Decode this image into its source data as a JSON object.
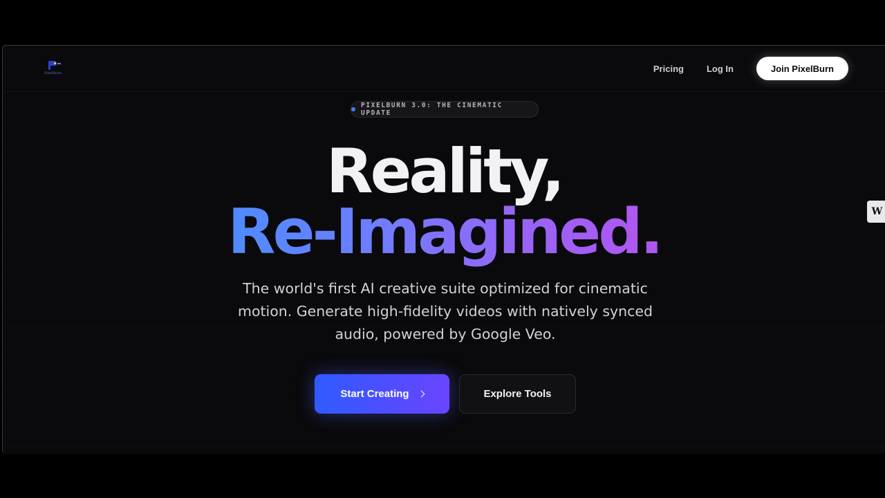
{
  "brand": {
    "name": "PixelBurn",
    "logo_text": "PixelBurn"
  },
  "nav": {
    "pricing_label": "Pricing",
    "login_label": "Log In",
    "join_label": "Join PixelBurn"
  },
  "badge": {
    "text": "PIXELBURN 3.0: THE CINEMATIC UPDATE"
  },
  "hero": {
    "headline_line1": "Reality,",
    "headline_line2": "Re-Imagined.",
    "subtext": "The world's first AI creative suite optimized for cinematic motion. Generate high-fidelity videos with natively synced audio, powered by Google Veo."
  },
  "cta": {
    "primary_label": "Start Creating",
    "secondary_label": "Explore Tools"
  },
  "side_widget": {
    "label": "W"
  },
  "colors": {
    "background": "#0a0a0c",
    "accent_blue": "#2f5bff",
    "accent_purple": "#b255f0",
    "badge_dot": "#4a7cff"
  }
}
